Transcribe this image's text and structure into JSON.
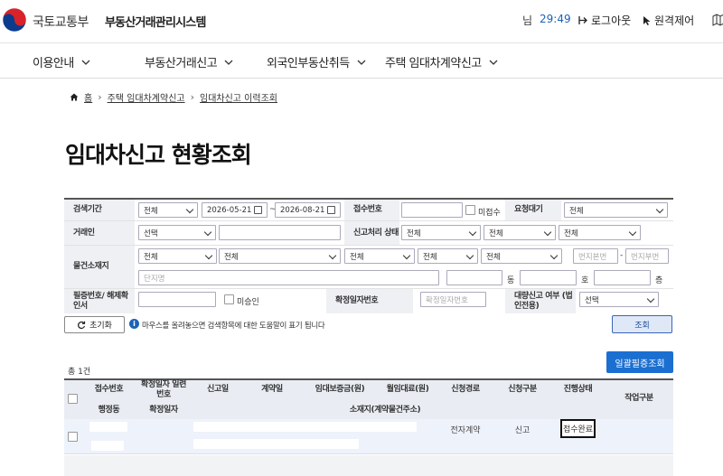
{
  "header": {
    "ministry": "국토교통부",
    "system_name": "부동산거래관리시스템",
    "user_suffix": "님",
    "timer": "29:49",
    "logout_label": "로그아웃",
    "remote_label": "원격제어"
  },
  "nav": {
    "items": [
      {
        "label": "이용안내"
      },
      {
        "label": "부동산거래신고"
      },
      {
        "label": "외국인부동산취득"
      },
      {
        "label": "주택 임대차계약신고"
      }
    ]
  },
  "breadcrumb": {
    "home": "홈",
    "level1": "주택 임대차계약신고",
    "level2": "임대차신고 이력조회"
  },
  "page_title": "임대차신고 현황조회",
  "form": {
    "period_label": "검색기간",
    "period_type": "전체",
    "date_from": "2026-05-21",
    "date_to": "2026-08-21",
    "tilde": "~",
    "receipt_no_label": "접수번호",
    "unreceived_label": "미접수",
    "request_wait_label": "요청대기",
    "request_wait_value": "전체",
    "party_label": "거래인",
    "party_select": "선택",
    "process_status_label": "신고처리 상태",
    "process_status_1": "전체",
    "process_status_2": "전체",
    "process_status_3": "전체",
    "property_label": "물건소재지",
    "addr_1": "전체",
    "addr_2": "전체",
    "addr_3": "전체",
    "addr_4": "전체",
    "addr_5": "전체",
    "bunji_main_placeholder": "번지본번",
    "bunji_sub_placeholder": "번지부번",
    "dash": "-",
    "complex_placeholder": "단지명",
    "dong_label": "동",
    "ho_label": "호",
    "floor_label": "층",
    "cert_label": "필증번호/ 해제확인서",
    "unapproved_label": "미승인",
    "confirm_date_no_label": "확정일자번호",
    "confirm_date_no_placeholder": "확정일자번호",
    "large_report_label": "대량신고 여부 (법인전용)",
    "large_report_select": "선택"
  },
  "actions": {
    "reset_label": "초기화",
    "info_text": "마우스를 올려놓으면 검색항목에 대한 도움말이 표기 됩니다",
    "search_label": "조회",
    "total": "총 1건",
    "bulk_label": "일괄필증조회"
  },
  "table": {
    "header_row1": [
      "접수번호",
      "확정일자 일련번호",
      "신고일",
      "계약일",
      "임대보증금(원)",
      "월임대료(원)",
      "신청경로",
      "신청구분",
      "진행상태"
    ],
    "header_row2": [
      "행정동",
      "확정일자",
      "소재지(계약물건주소)"
    ],
    "work_type_label": "작업구분",
    "rows": [
      {
        "channel": "전자계약",
        "type": "신고",
        "status": "접수완료"
      }
    ]
  }
}
